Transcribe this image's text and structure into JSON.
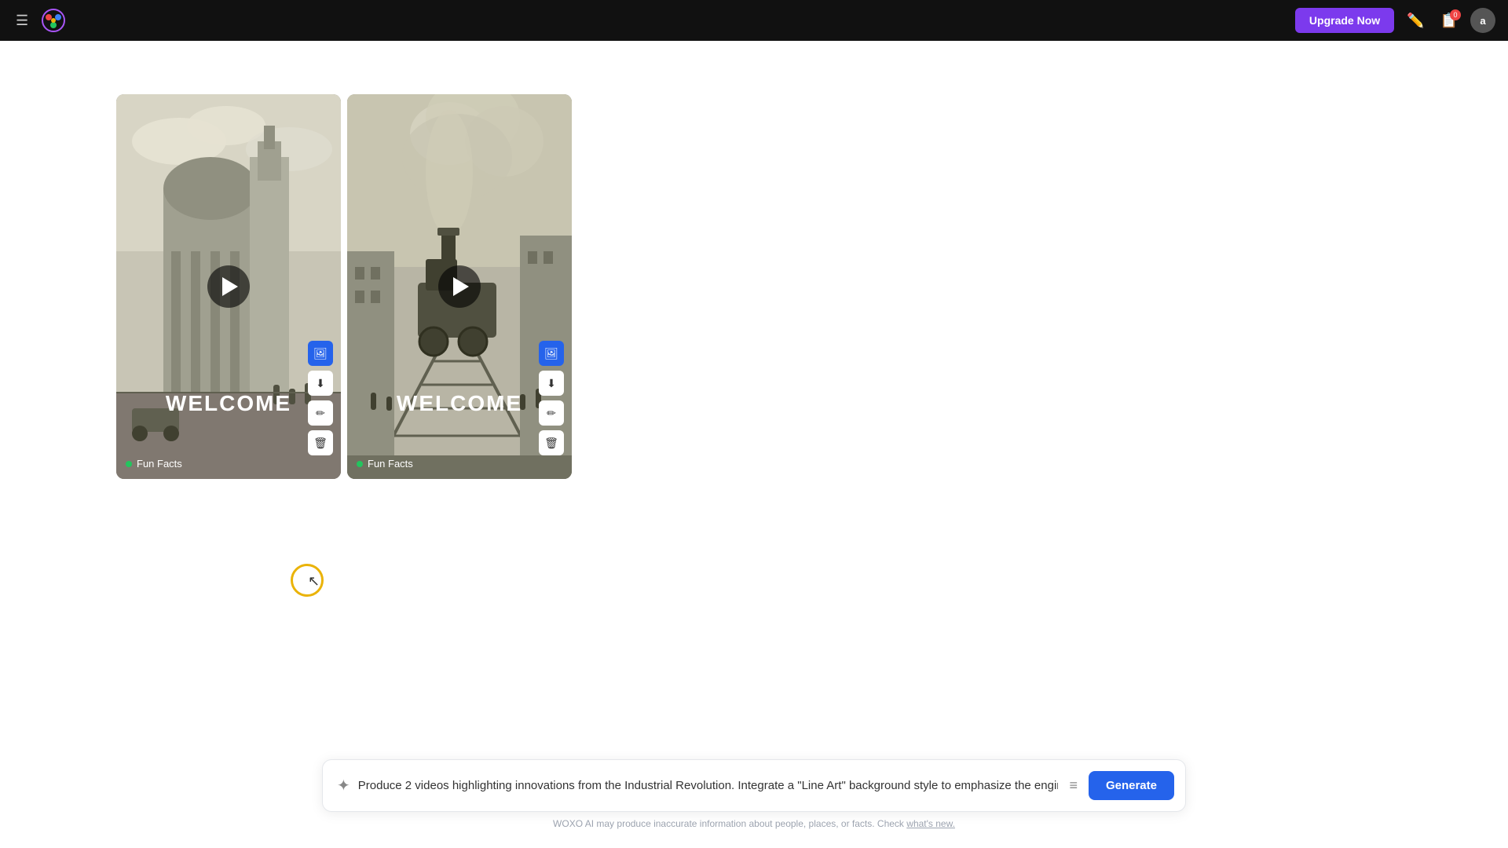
{
  "topnav": {
    "upgrade_label": "Upgrade Now",
    "avatar_initials": "a"
  },
  "cards": [
    {
      "id": "card-1",
      "title": "WELCOME",
      "tag": "Fun Facts",
      "actions": [
        "copy",
        "download",
        "edit",
        "delete"
      ]
    },
    {
      "id": "card-2",
      "title": "WELCOME",
      "tag": "Fun Facts",
      "actions": [
        "copy",
        "download",
        "edit",
        "delete"
      ]
    }
  ],
  "prompt": {
    "text": "Produce 2 videos highlighting innovations from the Industrial Revolution. Integrate a \"Line Art\" background style to emphasize the engineering and design",
    "generate_label": "Generate"
  },
  "disclaimer": {
    "text": "WOXO AI may produce inaccurate information about people, places, or facts. Check ",
    "link_text": "what's new."
  }
}
